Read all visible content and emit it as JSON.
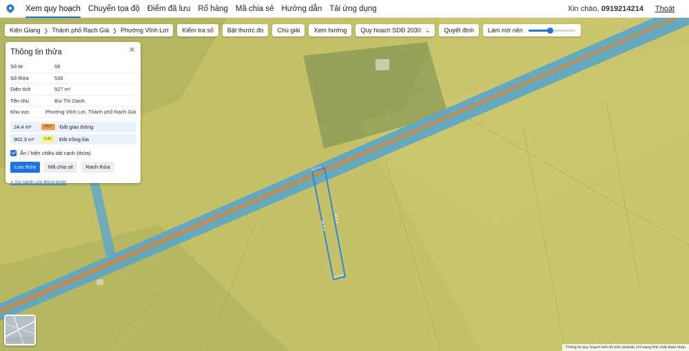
{
  "nav": {
    "items": [
      "Xem quy hoạch",
      "Chuyển tọa độ",
      "Điểm đã lưu",
      "Rổ hàng",
      "Mã chia sẻ",
      "Hướng dẫn",
      "Tải ứng dụng"
    ],
    "greeting": "Xin chào,",
    "phone": "0919214214",
    "logout": "Thoát"
  },
  "toolbar": {
    "breadcrumb": [
      "Kiên Giang",
      "Thành phố Rạch Giá",
      "Phường Vĩnh Lợi"
    ],
    "check_parcel": "Kiểm tra số",
    "toggle_measure": "Bật thước đo",
    "legend": "Chú giải",
    "view_direction": "Xem hướng",
    "plan_select": "Quy hoạch SDĐ 2030",
    "decision": "Quyết định",
    "blur_label": "Làm mờ nền",
    "blur_value": 0.45
  },
  "panel": {
    "title": "Thông tin thửa",
    "fields": [
      {
        "key": "Số tờ",
        "value": "68"
      },
      {
        "key": "Số thửa",
        "value": "538"
      },
      {
        "key": "Diện tích",
        "value": "927 m²"
      },
      {
        "key": "Tên chủ",
        "value": "Bùi Thị Oanh."
      },
      {
        "key": "Khu vực",
        "value": "Phường Vĩnh Lợi, Thành phố Rạch Giá"
      }
    ],
    "land_use": [
      {
        "area": "24.4 m²",
        "code": "DGT",
        "name": "Đất giao thông",
        "color": "#f0a04b"
      },
      {
        "area": "902.3 m²",
        "code": "LUC",
        "name": "Đất trồng lúa",
        "color": "#fdf67a"
      }
    ],
    "show_edges_label": "Ẩn / hiện chiều dài cạnh (thửa)",
    "show_edges": true,
    "save_button": "Lưu thửa",
    "share_button": "Mã chia sẻ",
    "boundary_button": "Ranh thửa",
    "compare_link": "+ So sánh với thửa khác"
  },
  "layer_button": "Lớp giao thông",
  "footer_note": "Thông tin quy hoạch hiển thị trên website chỉ mang tính chất tham khảo",
  "parcel_edges": [
    "10.0 m",
    "92.8 m",
    "92.8 m",
    "10.0 m"
  ],
  "colors": {
    "accent": "#1a73e8",
    "road": "#5aa6c8",
    "road_center": "#c98a4a",
    "rice_field": "#c9c56a"
  }
}
